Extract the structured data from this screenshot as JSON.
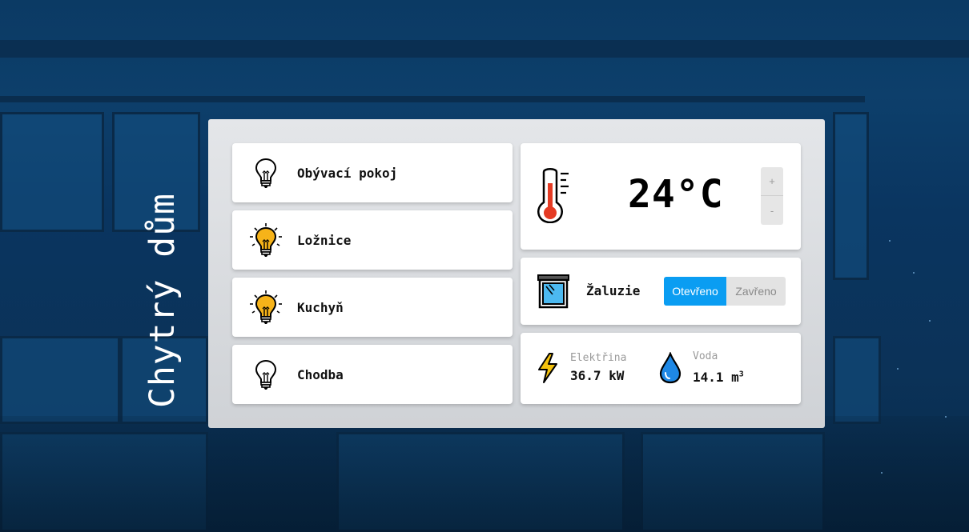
{
  "brand": {
    "title": "Chytrý dům"
  },
  "rooms": [
    {
      "label": "Obývací pokoj",
      "icon": "lightbulb-off-icon",
      "on": false
    },
    {
      "label": "Ložnice",
      "icon": "lightbulb-on-icon",
      "on": true
    },
    {
      "label": "Kuchyň",
      "icon": "lightbulb-on-icon",
      "on": true
    },
    {
      "label": "Chodba",
      "icon": "lightbulb-off-icon",
      "on": false
    }
  ],
  "thermostat": {
    "value": "24°C",
    "plus_label": "+",
    "minus_label": "-",
    "icon": "thermometer-icon"
  },
  "blinds": {
    "label": "Žaluzie",
    "open_label": "Otevřeno",
    "closed_label": "Zavřeno",
    "selected": "Otevřeno",
    "icon": "window-icon"
  },
  "usage": {
    "electricity": {
      "caption": "Elektřina",
      "value": "36.7 kW",
      "icon": "lightning-icon"
    },
    "water": {
      "caption": "Voda",
      "value": "14.1 m",
      "unit_exp": "3",
      "icon": "water-drop-icon"
    }
  },
  "colors": {
    "accent": "#0a9df2",
    "bulb_on": "#f6b319",
    "lightning": "#f4c20d",
    "water": "#1e88e5",
    "thermo_red": "#e53b24"
  }
}
